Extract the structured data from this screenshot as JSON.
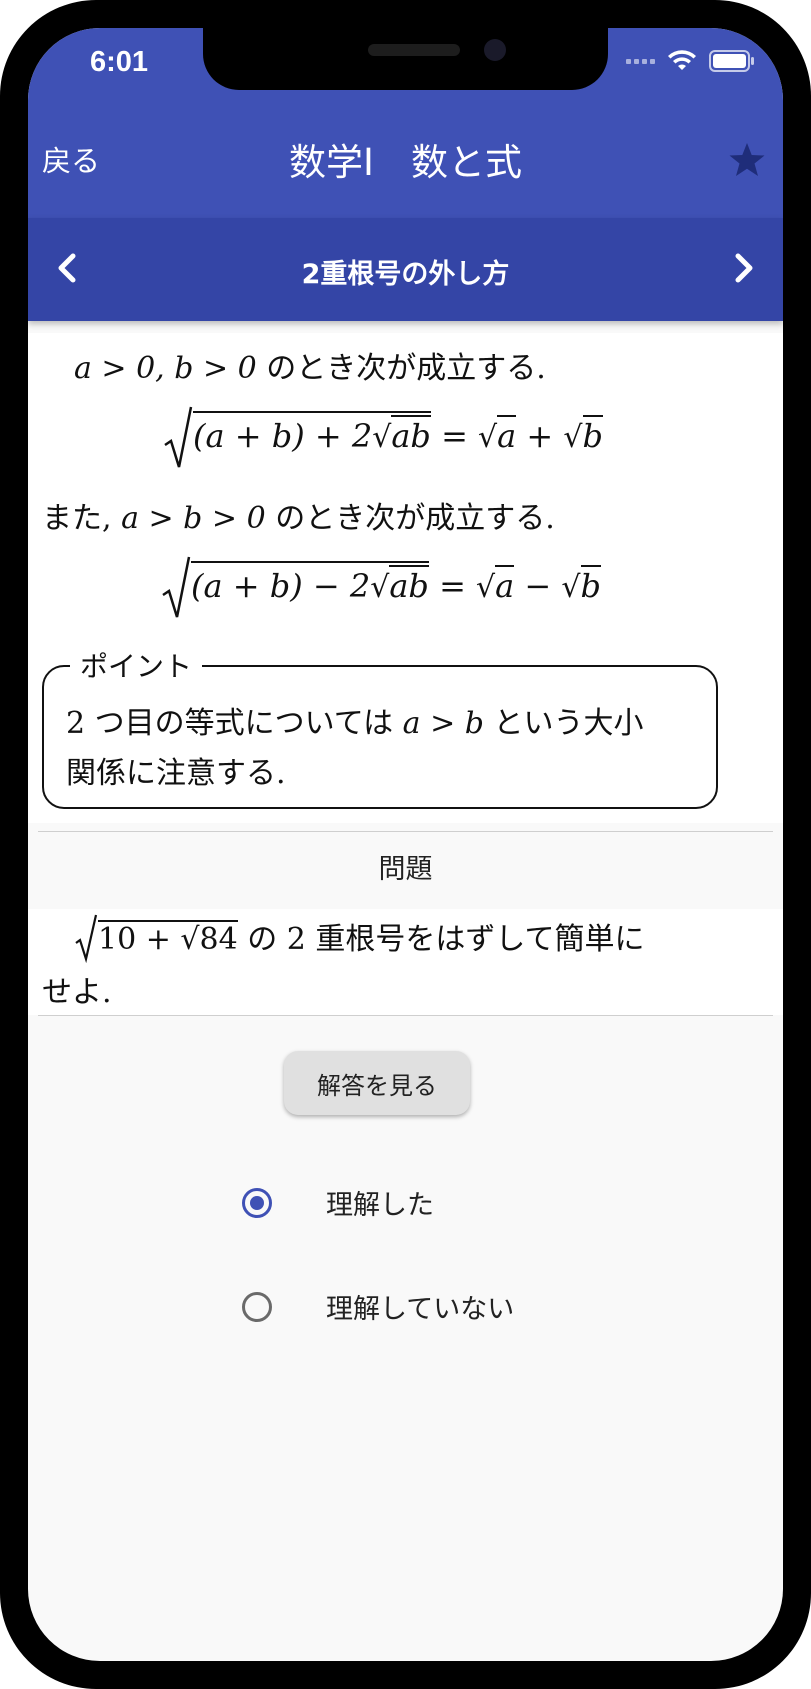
{
  "status": {
    "time": "6:01"
  },
  "nav": {
    "back_label": "戻る",
    "title": "数学I　数と式"
  },
  "section": {
    "title": "2重根号の外し方"
  },
  "content": {
    "line1_math": "a > 0, b > 0",
    "line1_text": " のとき次が成立する.",
    "formula1_lhs": "(a + b) + 2",
    "formula1_ab": "ab",
    "formula1_rhs": " = ",
    "formula1_a": "a",
    "formula1_plus": " + ",
    "formula1_b": "b",
    "line2_pre": "また, ",
    "line2_math": "a > b > 0",
    "line2_text": " のとき次が成立する.",
    "formula2_lhs": "(a + b) − 2",
    "formula2_ab": "ab",
    "formula2_rhs": " = ",
    "formula2_a": "a",
    "formula2_minus": " − ",
    "formula2_b": "b"
  },
  "point": {
    "label": "ポイント",
    "text_1": "2 つ目の等式については ",
    "text_math": "a > b",
    "text_2": " という大小",
    "text_3": "関係に注意する."
  },
  "problem": {
    "label": "問題",
    "expr_10": "10 + ",
    "expr_84": "84",
    "text_1": " の 2 重根号をはずして簡単に",
    "text_2": "せよ."
  },
  "answer_button": {
    "label": "解答を見る"
  },
  "options": [
    {
      "label": "理解した",
      "checked": true
    },
    {
      "label": "理解していない",
      "checked": false
    }
  ],
  "colors": {
    "primary": "#3f51b5",
    "primary_dark": "#3445a6"
  }
}
